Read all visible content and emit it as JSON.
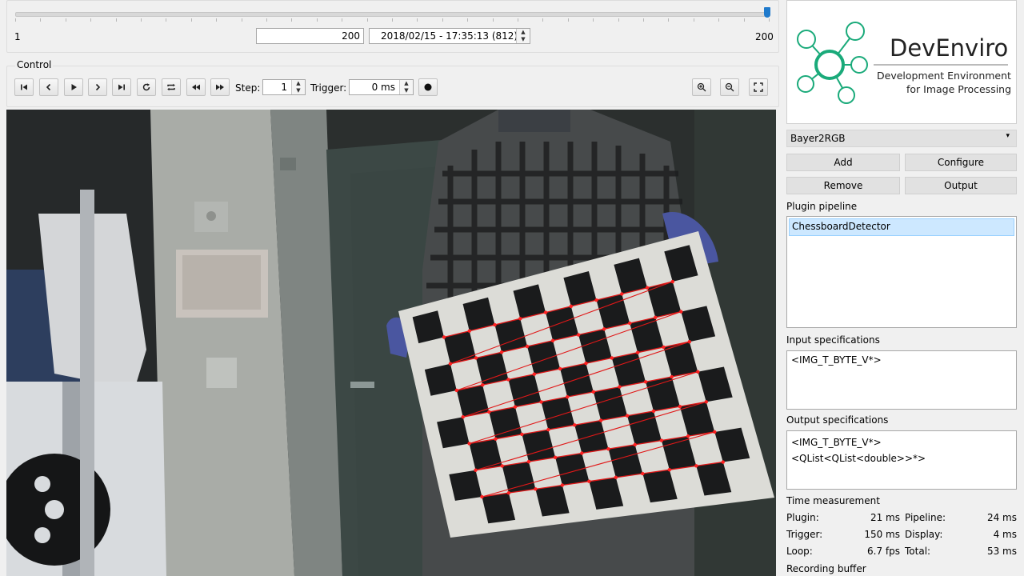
{
  "timeline": {
    "min_label": "1",
    "max_label": "200",
    "frame_value": "200",
    "timestamp_value": "2018/02/15 - 17:35:13 (812)",
    "position": 1.0
  },
  "control": {
    "group_title": "Control",
    "step_label": "Step:",
    "step_value": "1",
    "trigger_label": "Trigger:",
    "trigger_value": "0 ms",
    "buttons": [
      "first-frame-icon",
      "previous-frame-icon",
      "play-icon",
      "next-frame-icon",
      "last-frame-icon",
      "reload-icon",
      "loop-icon",
      "rewind-icon",
      "fast-forward-icon"
    ],
    "zoom_buttons": [
      "zoom-in-icon",
      "zoom-out-icon",
      "fit-to-window-icon"
    ]
  },
  "logo": {
    "name": "DevEnviro",
    "line1": "Development Environment",
    "line2": "for Image Processing",
    "accent": "#1aaa7a"
  },
  "plugin_select": {
    "selected": "Bayer2RGB"
  },
  "plugin_buttons": {
    "add": "Add",
    "configure": "Configure",
    "remove": "Remove",
    "output": "Output"
  },
  "pipeline": {
    "title": "Plugin pipeline",
    "items": [
      "ChessboardDetector"
    ]
  },
  "input_spec": {
    "title": "Input specifications",
    "lines": [
      "<IMG_T_BYTE_V*>"
    ]
  },
  "output_spec": {
    "title": "Output specifications",
    "lines": [
      "<IMG_T_BYTE_V*>",
      "<QList<QList<double>>*>"
    ]
  },
  "time": {
    "title": "Time measurement",
    "rows": [
      {
        "l1": "Plugin:",
        "v1": "21 ms",
        "l2": "Pipeline:",
        "v2": "24 ms"
      },
      {
        "l1": "Trigger:",
        "v1": "150 ms",
        "l2": "Display:",
        "v2": "4 ms"
      },
      {
        "l1": "Loop:",
        "v1": "6.7 fps",
        "l2": "Total:",
        "v2": "53 ms"
      }
    ]
  },
  "recording": {
    "title": "Recording buffer"
  }
}
